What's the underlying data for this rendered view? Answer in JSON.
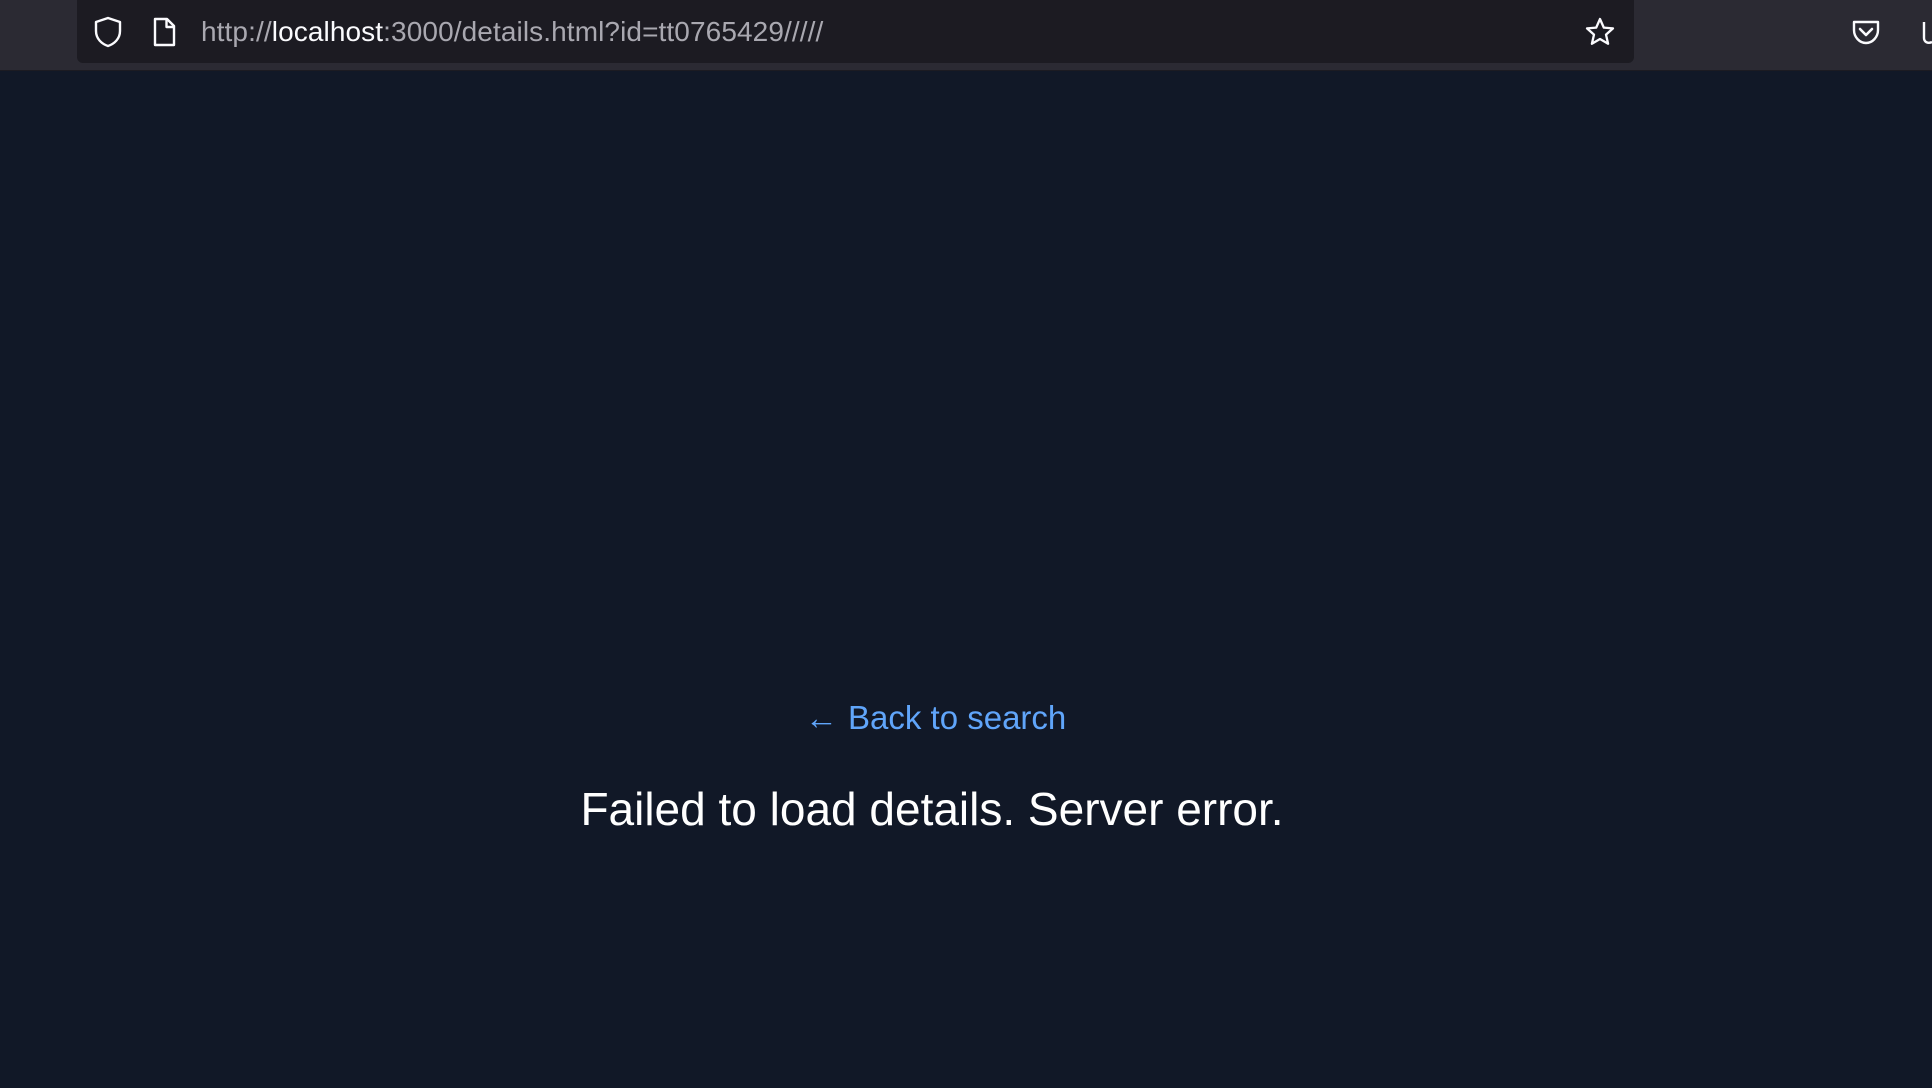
{
  "browser": {
    "url_scheme": "http://",
    "url_host": "localhost",
    "url_rest": ":3000/details.html?id=tt0765429/////",
    "icons": {
      "site_security": "shield-icon",
      "page": "page-icon",
      "bookmark": "star-icon",
      "pocket": "pocket-icon"
    }
  },
  "page": {
    "back_link": "Back to search",
    "back_arrow": "←",
    "error_message": "Failed to load details. Server error.",
    "colors": {
      "background": "#111827",
      "link": "#60a5fa",
      "text": "#ffffff"
    }
  }
}
